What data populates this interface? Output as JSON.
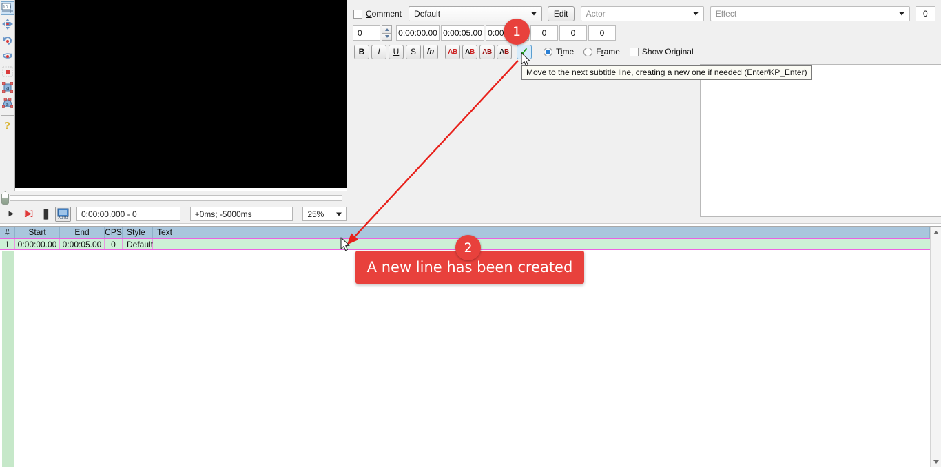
{
  "toolstrip": {
    "items": [
      {
        "name": "coordinates-tool",
        "label": "10.1"
      },
      {
        "name": "drag-move-tool",
        "label": ""
      },
      {
        "name": "rotate-z-tool",
        "label": ""
      },
      {
        "name": "rotate-xy-tool",
        "label": ""
      },
      {
        "name": "scale-tool",
        "label": ""
      },
      {
        "name": "rectangular-clip-tool",
        "label": ""
      },
      {
        "name": "vector-clip-tool",
        "label": ""
      },
      {
        "name": "help-tool",
        "label": "?"
      }
    ]
  },
  "playback": {
    "play_icon": "▶",
    "play_line_icon": "[▶]",
    "pause_icon": "▐▌",
    "auto_label": "AUTO",
    "time_value": "0:00:00.000 - 0",
    "offset_value": "+0ms; -5000ms",
    "zoom_value": "25%"
  },
  "editor": {
    "comment_label": "Comment",
    "comment_checked": false,
    "style_value": "Default",
    "edit_button": "Edit",
    "actor_placeholder": "Actor",
    "effect_placeholder": "Effect",
    "effect_layer_value": "0",
    "layer_value": "0",
    "start_time": "0:00:00.00",
    "end_time": "0:00:05.00",
    "duration_time": "0:00:05.00",
    "margin_l": "0",
    "margin_r": "0",
    "margin_v": "0",
    "format_buttons": [
      {
        "name": "bold-button",
        "label": "B"
      },
      {
        "name": "italic-button",
        "label": "I"
      },
      {
        "name": "underline-button",
        "label": "U"
      },
      {
        "name": "strikeout-button",
        "label": "S"
      },
      {
        "name": "font-button",
        "label": "fn"
      }
    ],
    "color_buttons": [
      {
        "name": "primary-color-button",
        "a": "A",
        "b": "B"
      },
      {
        "name": "secondary-color-button",
        "a": "A",
        "b": "B"
      },
      {
        "name": "outline-color-button",
        "a": "A",
        "b": "B"
      },
      {
        "name": "shadow-color-button",
        "a": "A",
        "b": "B"
      }
    ],
    "commit_button_icon": "✓",
    "time_radio_label": "Time",
    "time_radio_selected": true,
    "frame_radio_label": "Frame",
    "frame_radio_selected": false,
    "show_original_label": "Show Original",
    "show_original_checked": false,
    "subtitle_text": ""
  },
  "tooltip": {
    "text": "Move to the next subtitle line, creating a new one if needed (Enter/KP_Enter)"
  },
  "grid": {
    "columns": [
      "#",
      "Start",
      "End",
      "CPS",
      "Style",
      "Text"
    ],
    "rows": [
      {
        "index": "1",
        "start": "0:00:00.00",
        "end": "0:00:05.00",
        "cps": "0",
        "style": "Default",
        "text": ""
      }
    ]
  },
  "annotations": {
    "badge_1": "1",
    "badge_2": "2",
    "callout_text": "A new line has been created"
  },
  "colors": {
    "accent_red": "#e8413c",
    "selection_pink": "#ea63e0",
    "row_green": "#cdf0d6",
    "header_blue": "#a9c6dd",
    "check_green": "#1f9c1f"
  }
}
